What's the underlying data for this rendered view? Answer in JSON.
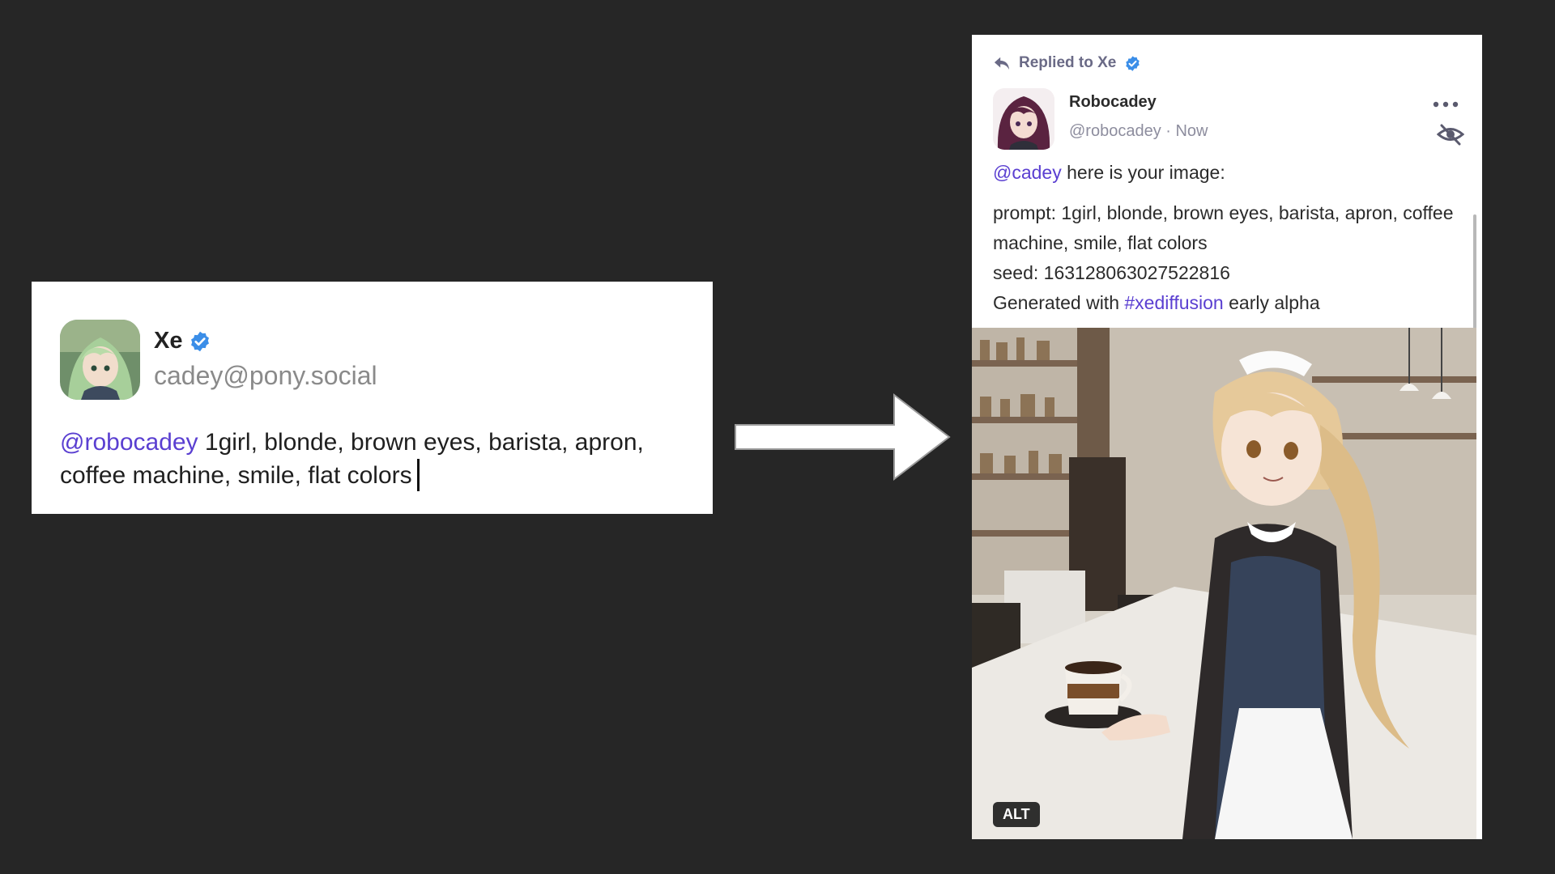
{
  "compose": {
    "name": "Xe",
    "handle": "cadey@pony.social",
    "mention": "@robocadey",
    "text": " 1girl, blonde, brown eyes, barista, apron, coffee machine, smile, flat colors"
  },
  "post": {
    "reply_label": "Replied to Xe",
    "author_name": "Robocadey",
    "author_handle": "@robocadey",
    "separator": " · ",
    "timestamp": "Now",
    "greeting_mention": "@cadey",
    "greeting_text": " here is your image:",
    "prompt_line": "prompt: 1girl, blonde, brown eyes, barista, apron, coffee machine, smile, flat colors",
    "seed_line": "seed: 163128063027522816",
    "generated_prefix": "Generated with ",
    "hashtag": "#xediffusion",
    "generated_suffix": " early alpha",
    "alt_badge": "ALT"
  },
  "colors": {
    "background": "#262626",
    "accent": "#5a3fd1",
    "verified": "#3b8ee8"
  },
  "icons": {
    "reply": "reply-arrow-icon",
    "verified": "verified-badge-icon",
    "more": "more-horizontal-icon",
    "hide": "eye-off-icon",
    "flow": "right-arrow-icon"
  }
}
